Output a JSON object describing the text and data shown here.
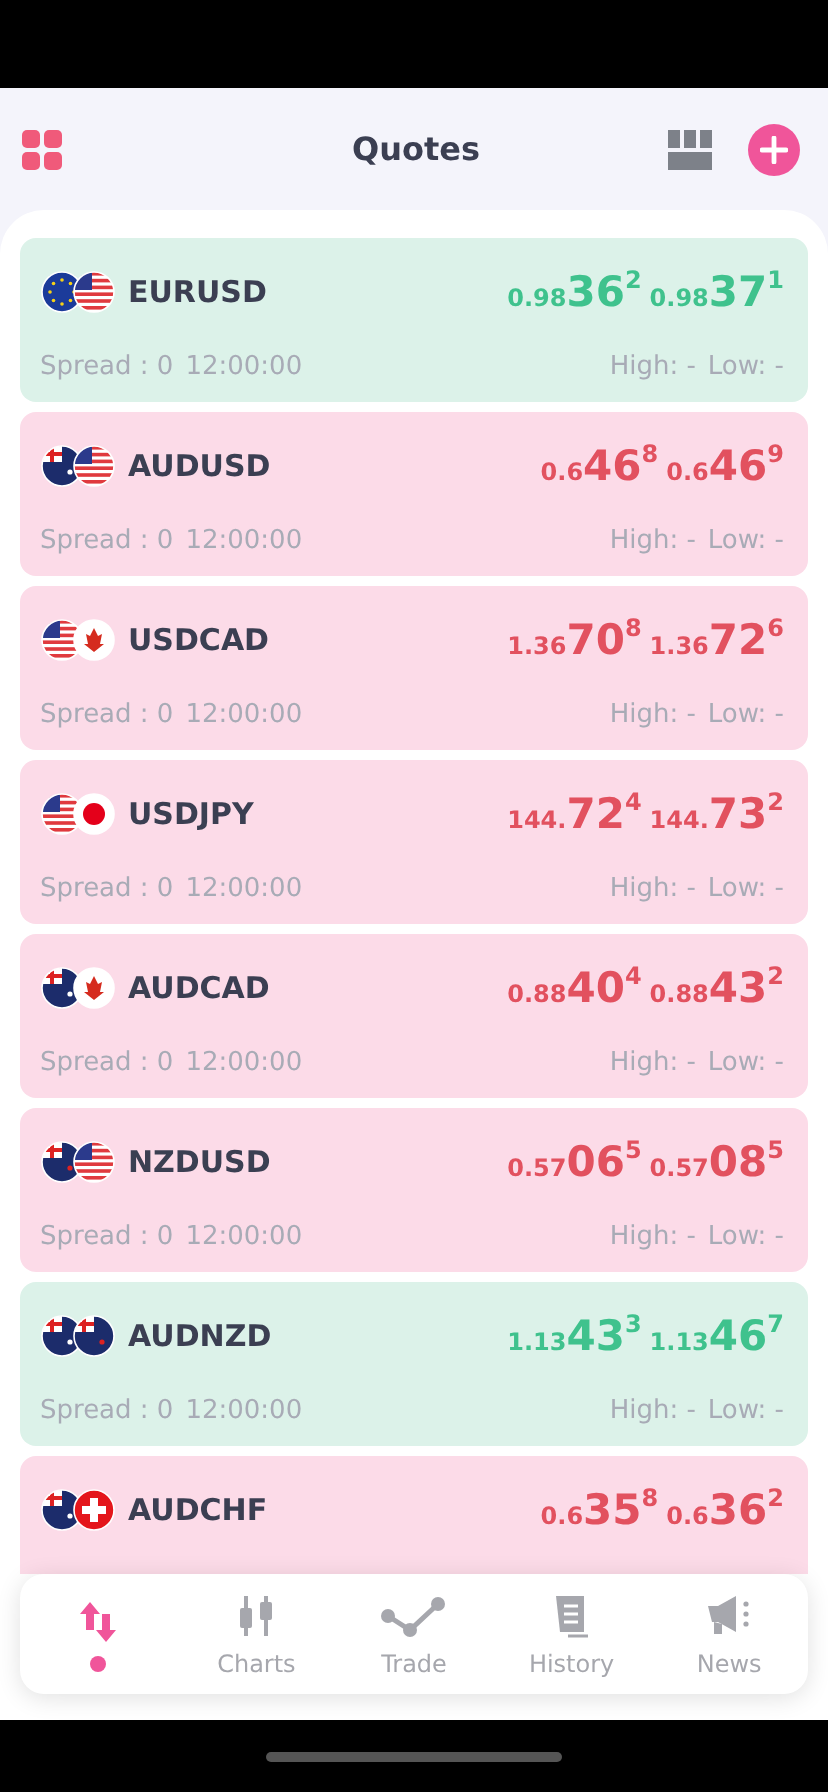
{
  "header": {
    "title": "Quotes"
  },
  "quotes": [
    {
      "symbol": "EURUSD",
      "flags": [
        {
          "kind": "eur"
        },
        {
          "kind": "usd"
        }
      ],
      "kind": "rise",
      "bid": {
        "prefix": "0.98",
        "big": "36",
        "pip": "2"
      },
      "ask": {
        "prefix": "0.98",
        "big": "37",
        "pip": "1"
      },
      "spread": "Spread : 0",
      "time": "12:00:00",
      "high": "High: -",
      "low": "Low: -"
    },
    {
      "symbol": "AUDUSD",
      "flags": [
        {
          "kind": "aud"
        },
        {
          "kind": "usd"
        }
      ],
      "kind": "fall",
      "bid": {
        "prefix": "0.6",
        "big": "46",
        "pip": "8"
      },
      "ask": {
        "prefix": "0.6",
        "big": "46",
        "pip": "9"
      },
      "spread": "Spread : 0",
      "time": "12:00:00",
      "high": "High: -",
      "low": "Low: -"
    },
    {
      "symbol": "USDCAD",
      "flags": [
        {
          "kind": "usd"
        },
        {
          "kind": "cad"
        }
      ],
      "kind": "fall",
      "bid": {
        "prefix": "1.36",
        "big": "70",
        "pip": "8"
      },
      "ask": {
        "prefix": "1.36",
        "big": "72",
        "pip": "6"
      },
      "spread": "Spread : 0",
      "time": "12:00:00",
      "high": "High: -",
      "low": "Low: -"
    },
    {
      "symbol": "USDJPY",
      "flags": [
        {
          "kind": "usd"
        },
        {
          "kind": "jpy"
        }
      ],
      "kind": "fall",
      "bid": {
        "prefix": "144.",
        "big": "72",
        "pip": "4"
      },
      "ask": {
        "prefix": "144.",
        "big": "73",
        "pip": "2"
      },
      "spread": "Spread : 0",
      "time": "12:00:00",
      "high": "High: -",
      "low": "Low: -"
    },
    {
      "symbol": "AUDCAD",
      "flags": [
        {
          "kind": "aud"
        },
        {
          "kind": "cad"
        }
      ],
      "kind": "fall",
      "bid": {
        "prefix": "0.88",
        "big": "40",
        "pip": "4"
      },
      "ask": {
        "prefix": "0.88",
        "big": "43",
        "pip": "2"
      },
      "spread": "Spread : 0",
      "time": "12:00:00",
      "high": "High: -",
      "low": "Low: -"
    },
    {
      "symbol": "NZDUSD",
      "flags": [
        {
          "kind": "nzd"
        },
        {
          "kind": "usd"
        }
      ],
      "kind": "fall",
      "bid": {
        "prefix": "0.57",
        "big": "06",
        "pip": "5"
      },
      "ask": {
        "prefix": "0.57",
        "big": "08",
        "pip": "5"
      },
      "spread": "Spread : 0",
      "time": "12:00:00",
      "high": "High: -",
      "low": "Low: -"
    },
    {
      "symbol": "AUDNZD",
      "flags": [
        {
          "kind": "aud"
        },
        {
          "kind": "nzd"
        }
      ],
      "kind": "rise",
      "bid": {
        "prefix": "1.13",
        "big": "43",
        "pip": "3"
      },
      "ask": {
        "prefix": "1.13",
        "big": "46",
        "pip": "7"
      },
      "spread": "Spread : 0",
      "time": "12:00:00",
      "high": "High: -",
      "low": "Low: -"
    },
    {
      "symbol": "AUDCHF",
      "flags": [
        {
          "kind": "aud"
        },
        {
          "kind": "chf"
        }
      ],
      "kind": "fall",
      "bid": {
        "prefix": "0.6",
        "big": "35",
        "pip": "8"
      },
      "ask": {
        "prefix": "0.6",
        "big": "36",
        "pip": "2"
      }
    }
  ],
  "tab_bar": [
    {
      "kind": "arrows",
      "selected": true
    },
    {
      "kind": "candles",
      "label": "Charts",
      "selected": false
    },
    {
      "kind": "trade",
      "label": "Trade",
      "selected": false
    },
    {
      "kind": "history",
      "label": "History",
      "selected": false
    },
    {
      "kind": "news",
      "label": "News",
      "selected": false
    }
  ]
}
